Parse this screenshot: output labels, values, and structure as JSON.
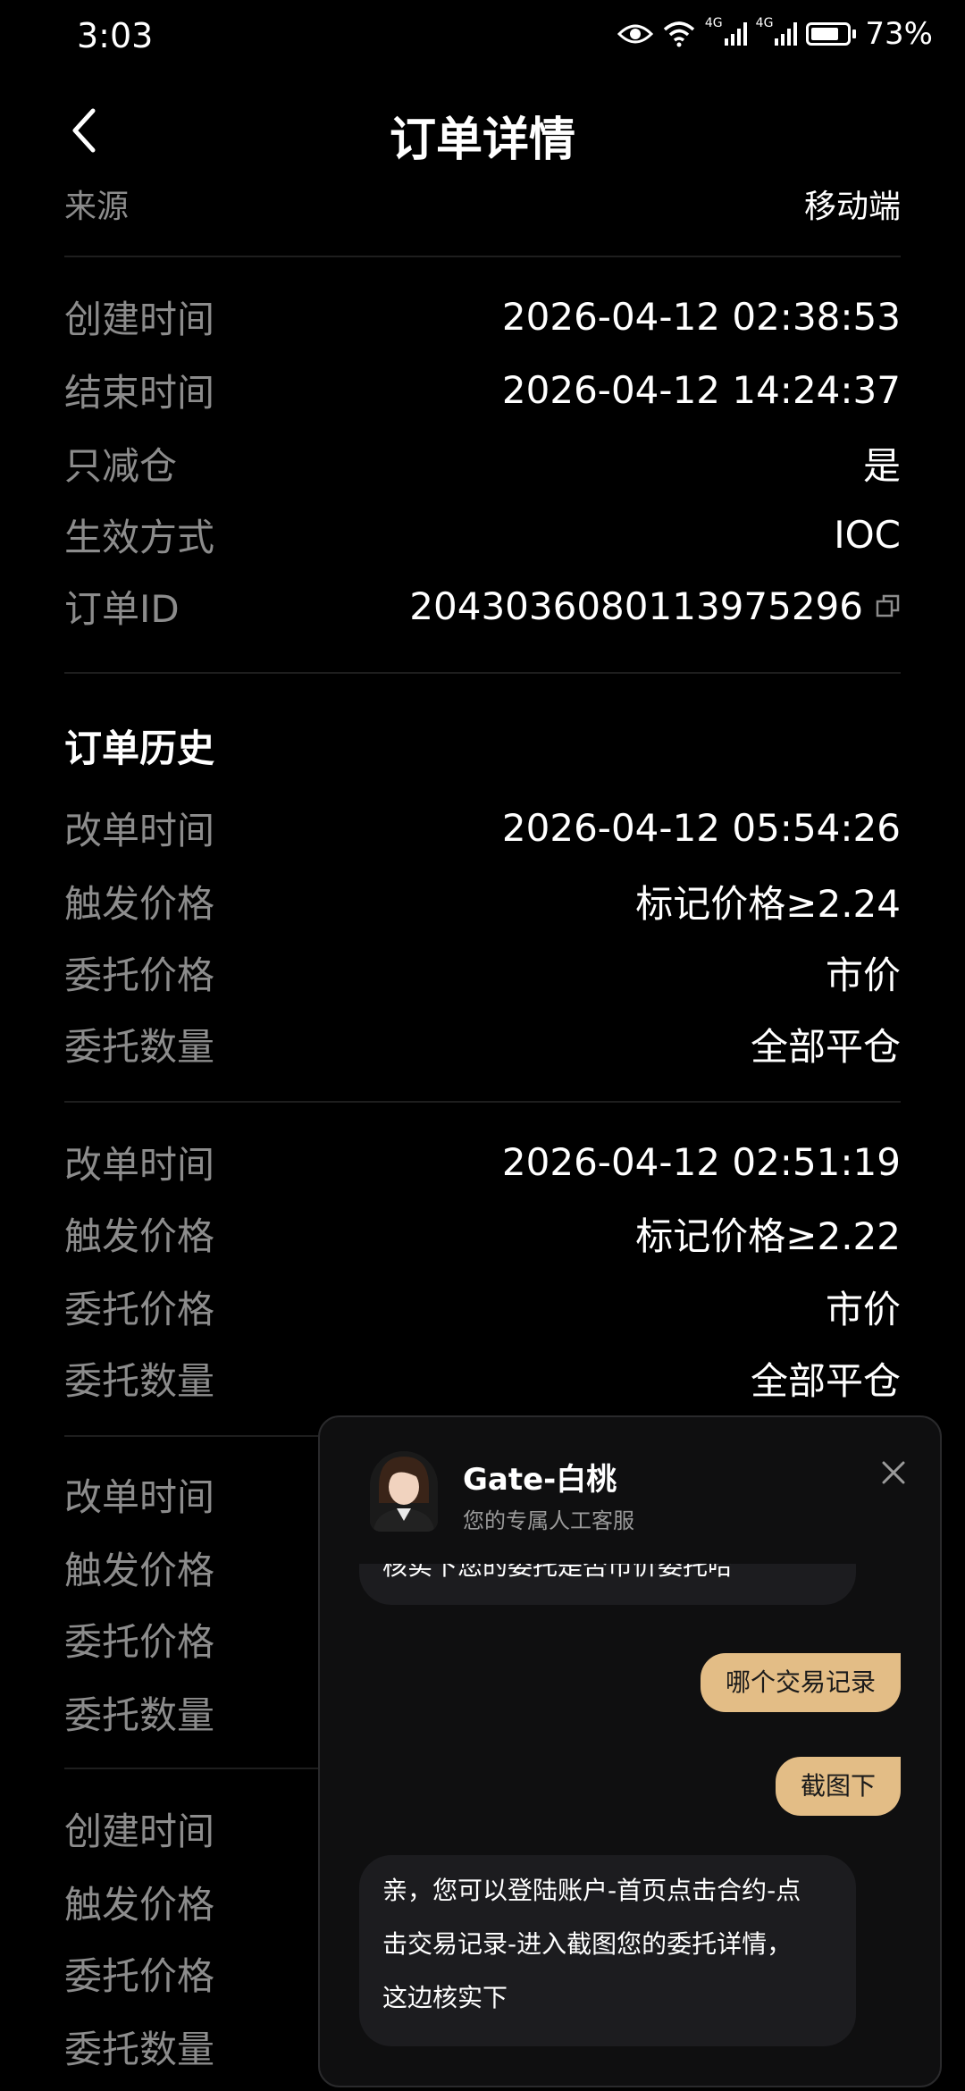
{
  "status_bar": {
    "time": "3:03",
    "battery": "73%",
    "network_labels": [
      "4G",
      "4G"
    ]
  },
  "header": {
    "title": "订单详情"
  },
  "details": [
    {
      "label": "来源",
      "value": "移动端"
    },
    {
      "label": "创建时间",
      "value": "2026-04-12 02:38:53"
    },
    {
      "label": "结束时间",
      "value": "2026-04-12 14:24:37"
    },
    {
      "label": "只减仓",
      "value": "是"
    },
    {
      "label": "生效方式",
      "value": "IOC"
    },
    {
      "label": "订单ID",
      "value": "2043036080113975296"
    }
  ],
  "history": {
    "title": "订单历史",
    "groups": [
      {
        "rows": [
          {
            "label": "改单时间",
            "value": "2026-04-12 05:54:26"
          },
          {
            "label": "触发价格",
            "value": "标记价格≥2.24"
          },
          {
            "label": "委托价格",
            "value": "市价"
          },
          {
            "label": "委托数量",
            "value": "全部平仓"
          }
        ]
      },
      {
        "rows": [
          {
            "label": "改单时间",
            "value": "2026-04-12 02:51:19"
          },
          {
            "label": "触发价格",
            "value": "标记价格≥2.22"
          },
          {
            "label": "委托价格",
            "value": "市价"
          },
          {
            "label": "委托数量",
            "value": "全部平仓"
          }
        ]
      },
      {
        "rows": [
          {
            "label": "改单时间",
            "value": ""
          },
          {
            "label": "触发价格",
            "value": ""
          },
          {
            "label": "委托价格",
            "value": ""
          },
          {
            "label": "委托数量",
            "value": ""
          }
        ]
      },
      {
        "rows": [
          {
            "label": "创建时间",
            "value": ""
          },
          {
            "label": "触发价格",
            "value": ""
          },
          {
            "label": "委托价格",
            "value": ""
          },
          {
            "label": "委托数量",
            "value": ""
          }
        ]
      }
    ]
  },
  "chat": {
    "agent_name": "Gate-白桃",
    "agent_subtitle": "您的专属人工客服",
    "messages": [
      {
        "from": "agent",
        "text": "核实下您的委托是否市价委托哈"
      },
      {
        "from": "user",
        "text": "哪个交易记录"
      },
      {
        "from": "user",
        "text": "截图下"
      },
      {
        "from": "agent",
        "lines": [
          "亲，您可以登陆账户-首页点击合约-点",
          "击交易记录-进入截图您的委托详情，",
          "这边核实下"
        ]
      }
    ]
  },
  "colors": {
    "background": "#000000",
    "label_gray": "#8c8c8c",
    "chat_user_bubble": "#e3bd86",
    "chat_agent_bubble": "#1c1c1f"
  }
}
